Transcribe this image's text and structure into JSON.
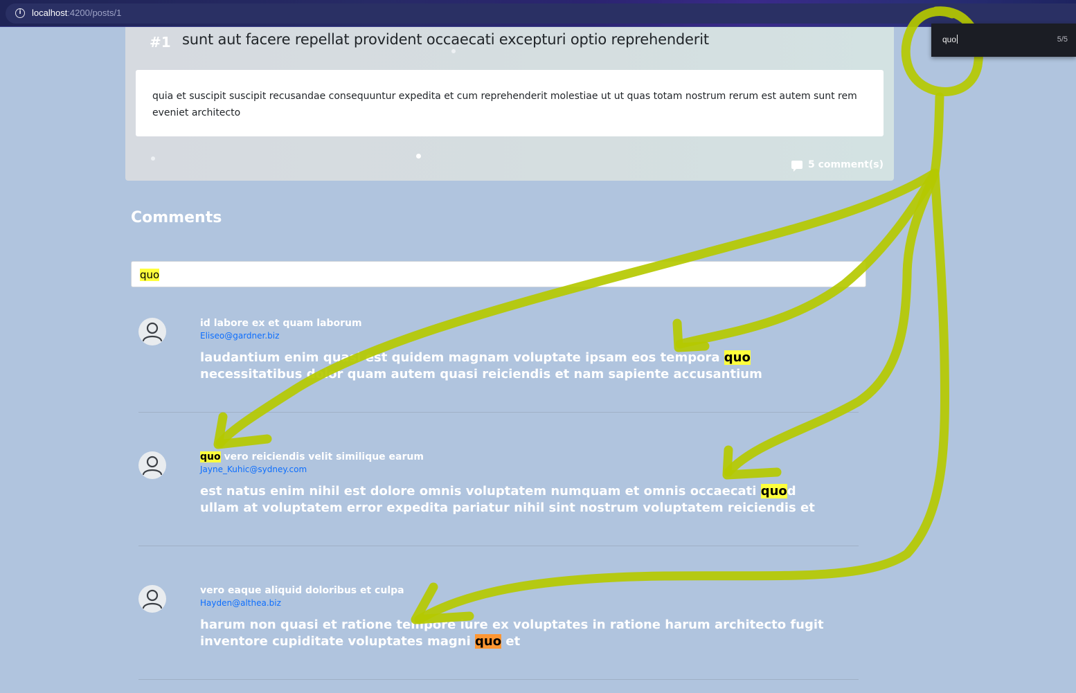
{
  "browser": {
    "url_host": "localhost",
    "url_rest": ":4200/posts/1"
  },
  "find_bar": {
    "query": "quo",
    "match_count": "5/5"
  },
  "post": {
    "number": "#1",
    "title": "sunt aut facere repellat provident occaecati excepturi optio reprehenderit",
    "body": "quia et suscipit suscipit recusandae consequuntur expedita et cum reprehenderit molestiae ut ut quas totam nostrum rerum est autem sunt rem eveniet architecto",
    "comment_count": "5 comment(s)"
  },
  "comments_section": {
    "heading": "Comments",
    "filter_value": "quo"
  },
  "comments": [
    {
      "name": "id labore ex et quam laborum",
      "email": "Eliseo@gardner.biz",
      "body_before": "laudantium enim quasi est quidem magnam voluptate ipsam eos tempora ",
      "body_match": "quo",
      "body_after": " necessitatibus dolor quam autem quasi reiciendis et nam sapiente accusantium"
    },
    {
      "name_match": "quo",
      "name_rest": " vero reiciendis velit similique earum",
      "email": "Jayne_Kuhic@sydney.com",
      "body_before": "est natus enim nihil est dolore omnis voluptatem numquam et omnis occaecati ",
      "body_match": "quo",
      "body_after": "d ullam at voluptatem error expedita pariatur nihil sint nostrum voluptatem reiciendis et"
    },
    {
      "name": "vero eaque aliquid doloribus et culpa",
      "email": "Hayden@althea.biz",
      "body_before": "harum non quasi et ratione tempore iure ex voluptates in ratione harum architecto fugit inventore cupiditate voluptates magni ",
      "body_match": "quo",
      "body_after": " et"
    }
  ],
  "colors": {
    "page_bg": "#b0c4de",
    "highlight": "#ffff3c",
    "highlight_active": "#ff9632",
    "email_link": "#0d6efd",
    "annotation": "#b5c900"
  }
}
